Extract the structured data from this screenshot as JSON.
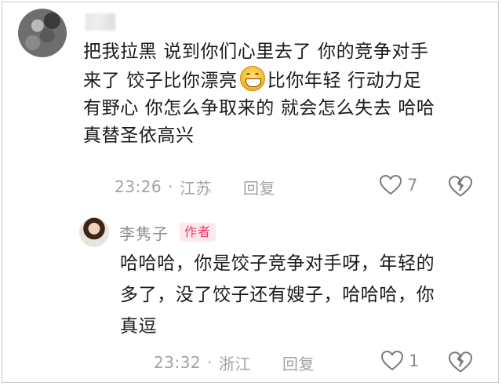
{
  "comment": {
    "username_blurred": true,
    "lines": [
      "把我拉黑 说到你们心里去了 你的竞争对手",
      "来了 饺子比你漂亮",
      "比你年轻 行动力足",
      "有野心 你怎么争取来的 就会怎么失去 哈哈",
      "真替圣依高兴"
    ],
    "emoji": "grinning-face-emoji",
    "time": "23:26",
    "dot": "·",
    "location": "江苏",
    "reply_label": "回复",
    "likes": "7"
  },
  "reply": {
    "username": "李隽子",
    "badge": "作者",
    "lines": [
      "哈哈哈，你是饺子竞争对手呀，年轻的",
      "多了，没了饺子还有嫂子，哈哈哈，你",
      "真逗"
    ],
    "time": "23:32",
    "dot": "·",
    "location": "浙江",
    "reply_label": "回复",
    "likes": "1"
  }
}
